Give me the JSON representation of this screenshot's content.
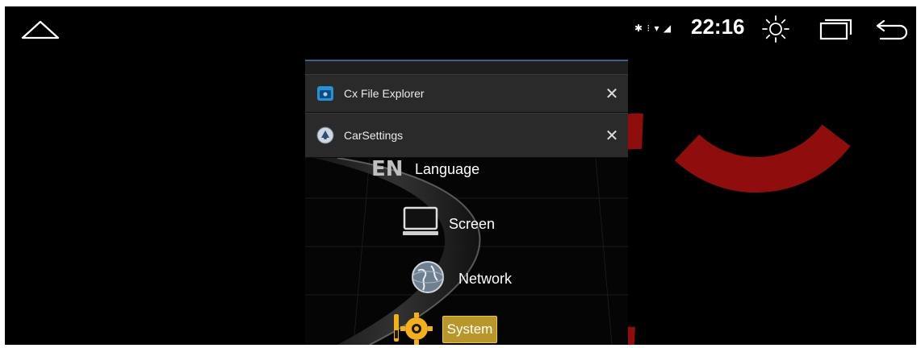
{
  "status_bar": {
    "signal_icons": "✱ ⁝ ▾ ◢",
    "time": "22:16"
  },
  "recents": {
    "tasks": [
      {
        "name": "Cx File Explorer",
        "icon": "folder-icon"
      },
      {
        "name": "CarSettings",
        "icon": "carsettings-icon"
      }
    ],
    "close_glyph": "✕"
  },
  "carsettings_preview": {
    "menu": [
      {
        "label": "Language",
        "icon": "language-en-icon",
        "badge": "EN"
      },
      {
        "label": "Screen",
        "icon": "monitor-icon"
      },
      {
        "label": "Network",
        "icon": "globe-icon"
      },
      {
        "label": "System",
        "icon": "gear-tools-icon",
        "selected": true
      }
    ]
  },
  "colors": {
    "watermark": "#c81212",
    "accent": "#3f5f8a",
    "system_highlight": "#b8962a"
  }
}
